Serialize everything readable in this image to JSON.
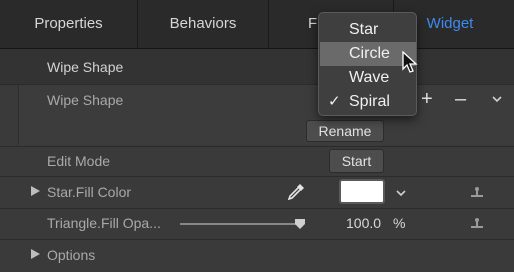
{
  "tabs": [
    {
      "label": "Properties"
    },
    {
      "label": "Behaviors"
    },
    {
      "label": "Fi"
    },
    {
      "label": "Widget"
    }
  ],
  "section_header": {
    "label": "Wipe Shape"
  },
  "wipe_row": {
    "label": "Wipe Shape",
    "add": "+",
    "remove": "–",
    "rename_label": "Rename"
  },
  "edit_row": {
    "label": "Edit Mode",
    "start_label": "Start"
  },
  "star_row": {
    "label": "Star.Fill Color",
    "color_value": "#ffffff"
  },
  "triangle_row": {
    "label": "Triangle.Fill Opa...",
    "value": "100.0",
    "unit": "%",
    "slider_fraction": 1.0
  },
  "options_row": {
    "label": "Options"
  },
  "dropdown_menu": {
    "items": [
      {
        "label": "Star",
        "checked": false,
        "highlighted": false
      },
      {
        "label": "Circle",
        "checked": false,
        "highlighted": true
      },
      {
        "label": "Wave",
        "checked": false,
        "highlighted": false
      },
      {
        "label": "Spiral",
        "checked": true,
        "highlighted": false
      }
    ],
    "check_glyph": "✓"
  },
  "colors": {
    "accent": "#3d8bf2",
    "panel": "#3a3a3a",
    "tabbar": "#2a2a2a"
  }
}
